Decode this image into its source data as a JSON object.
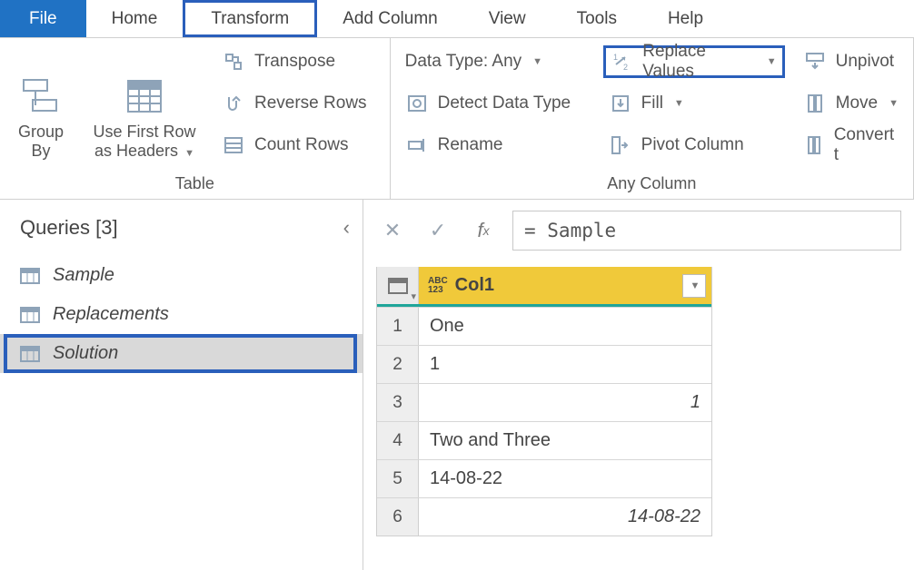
{
  "tabs": {
    "file": "File",
    "home": "Home",
    "transform": "Transform",
    "addcol": "Add Column",
    "view": "View",
    "tools": "Tools",
    "help": "Help"
  },
  "ribbon": {
    "table_label": "Table",
    "anycol_label": "Any Column",
    "group_by": "Group\nBy",
    "first_row": "Use First Row\nas Headers",
    "transpose": "Transpose",
    "reverse": "Reverse Rows",
    "count": "Count Rows",
    "datatype": "Data Type: Any",
    "detect": "Detect Data Type",
    "rename": "Rename",
    "replace": "Replace Values",
    "fill": "Fill",
    "pivot": "Pivot Column",
    "unpivot": "Unpivot",
    "move": "Move",
    "convert": "Convert t"
  },
  "sidebar": {
    "title": "Queries [3]",
    "items": [
      "Sample",
      "Replacements",
      "Solution"
    ],
    "selected": 2
  },
  "formula": "= Sample",
  "table": {
    "col": "Col1",
    "rows": [
      {
        "n": "1",
        "v": "One",
        "align": "left"
      },
      {
        "n": "2",
        "v": "1",
        "align": "left"
      },
      {
        "n": "3",
        "v": "1",
        "align": "right"
      },
      {
        "n": "4",
        "v": "Two and Three",
        "align": "left"
      },
      {
        "n": "5",
        "v": "14-08-22",
        "align": "left"
      },
      {
        "n": "6",
        "v": "14-08-22",
        "align": "right"
      }
    ]
  }
}
